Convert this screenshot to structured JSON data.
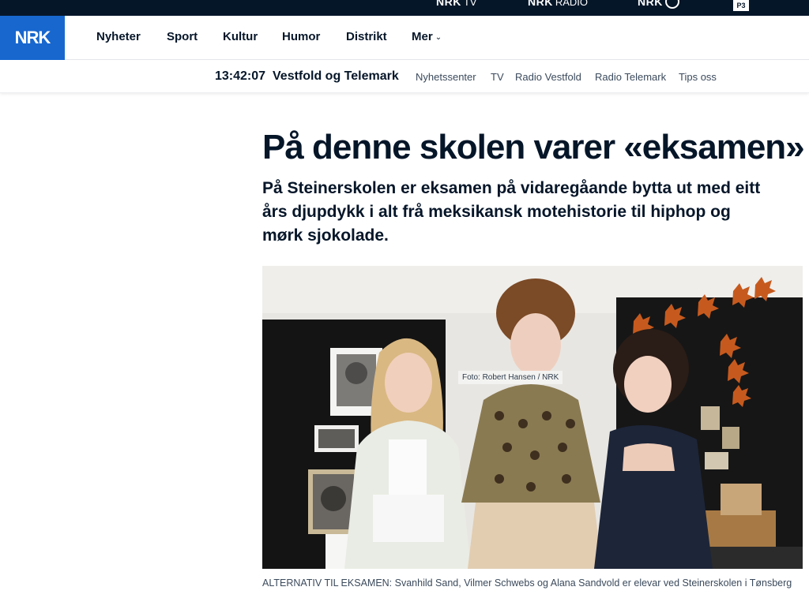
{
  "topbar": {
    "items": [
      {
        "brand": "NRK",
        "sub": "TV"
      },
      {
        "brand": "NRK",
        "sub": "RADIO"
      },
      {
        "brand": "NRK",
        "sub": ""
      },
      {
        "brand": "P3",
        "sub": ""
      }
    ]
  },
  "nav": {
    "logo": "NRK",
    "items": [
      "Nyheter",
      "Sport",
      "Kultur",
      "Humor",
      "Distrikt",
      "Mer"
    ]
  },
  "subnav": {
    "clock": "13:42:07",
    "district": "Vestfold og Telemark",
    "links": [
      "Nyhetssenter",
      "TV",
      "Radio Vestfold",
      "Radio Telemark",
      "Tips oss"
    ]
  },
  "article": {
    "headline": "På denne skolen varer «eksamen»",
    "lead": "På Steinerskolen er eksamen på vidaregåande bytta ut med eitt års djupdykk i alt frå meksikansk motehistorie til hiphop og mørk sjokolade.",
    "photo_credit": "Foto: Robert Hansen / NRK",
    "caption": "ALTERNATIV TIL EKSAMEN: Svanhild Sand, Vilmer Schwebs og Alana Sandvold er elevar ved Steinerskolen i Tønsberg"
  },
  "colors": {
    "topbar_bg": "#061629",
    "logo_bg": "#1767ce",
    "text": "#061629",
    "leaf": "#c65a1e"
  }
}
